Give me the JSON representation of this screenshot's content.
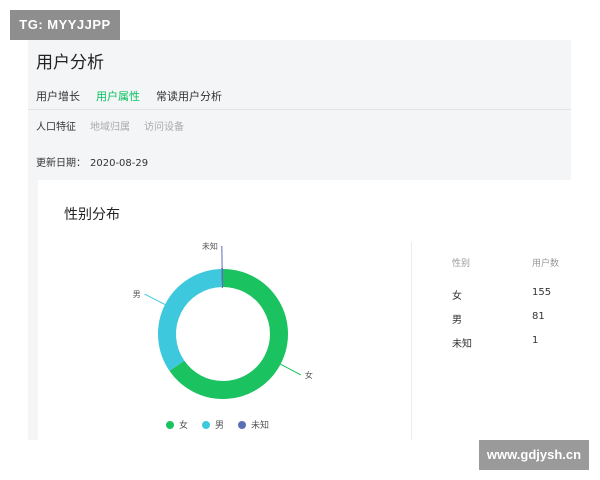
{
  "watermarks": {
    "top_left": "TG: MYYJJPP",
    "bottom_right": "www.gdjysh.cn"
  },
  "page": {
    "title": "用户分析"
  },
  "tabs": [
    {
      "label": "用户增长",
      "active": false
    },
    {
      "label": "用户属性",
      "active": true
    },
    {
      "label": "常读用户分析",
      "active": false
    }
  ],
  "subtabs": [
    {
      "label": "人口特征",
      "active": true
    },
    {
      "label": "地域归属",
      "active": false
    },
    {
      "label": "访问设备",
      "active": false
    }
  ],
  "update": {
    "label": "更新日期：",
    "value": "2020-08-29"
  },
  "card": {
    "title": "性别分布"
  },
  "table": {
    "headers": [
      "性别",
      "用户数"
    ],
    "rows": [
      {
        "gender": "女",
        "count": "155"
      },
      {
        "gender": "男",
        "count": "81"
      },
      {
        "gender": "未知",
        "count": "1"
      }
    ]
  },
  "colors": {
    "accent": "#07c160",
    "female": "#1ac260",
    "male": "#3ec8dd",
    "unknown": "#5b6fb5"
  },
  "chart_data": {
    "type": "pie",
    "variant": "donut",
    "slices": [
      {
        "label": "女",
        "value": 155
      },
      {
        "label": "男",
        "value": 81
      },
      {
        "label": "未知",
        "value": 1
      }
    ],
    "legend": [
      "女",
      "男",
      "未知"
    ],
    "legend_placement": "bottom"
  }
}
